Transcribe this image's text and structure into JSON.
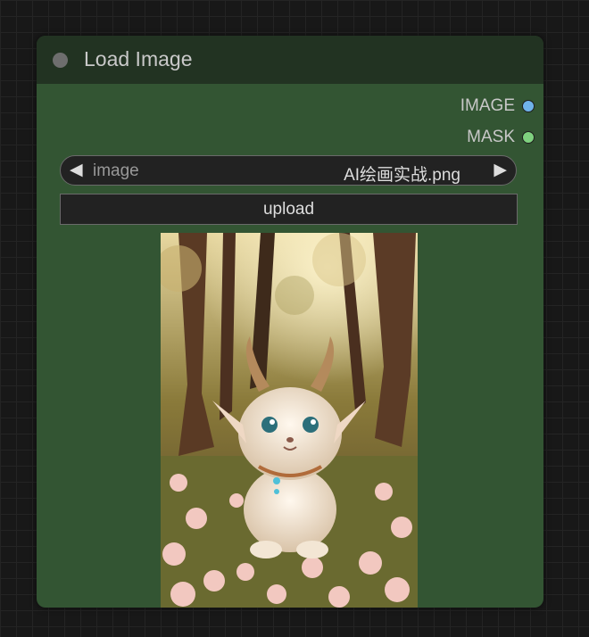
{
  "node": {
    "title": "Load Image",
    "outputs": [
      {
        "label": "IMAGE",
        "color": "#6fb3ea"
      },
      {
        "label": "MASK",
        "color": "#7fd17f"
      }
    ],
    "widgets": {
      "image_combo": {
        "name": "image",
        "value": "AI绘画实战.png",
        "left_arrow": "◀",
        "right_arrow": "▶"
      },
      "upload_label": "upload"
    }
  },
  "colors": {
    "canvas_bg": "#181818",
    "node_body": "#335533",
    "node_header": "#223322",
    "widget_bg": "#222222"
  }
}
